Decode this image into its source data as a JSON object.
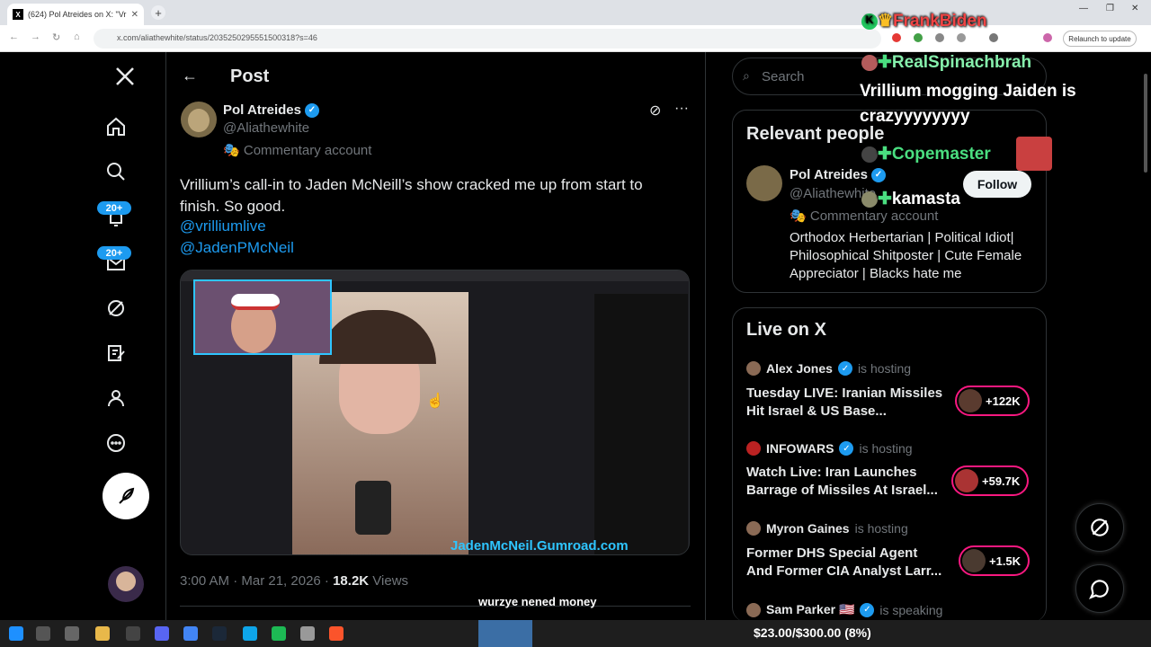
{
  "browser": {
    "tab_title": "(624) Pol Atreides on X: \"Vr",
    "url": "x.com/aliathewhite/status/2035250295551500318?s=46",
    "relaunch_label": "Relaunch to update"
  },
  "nav": {
    "notifications_badge": "20+",
    "messages_badge": "20+"
  },
  "post": {
    "header": "Post",
    "author_name": "Pol Atreides",
    "author_handle": "@Aliathewhite",
    "account_label": "Commentary account",
    "text": "Vrillium’s call-in to Jaden McNeill’s show cracked me up from start to finish. So good.",
    "mention1": "@vrilliumlive",
    "mention2": "@JadenPMcNeil",
    "timestamp": "3:00 AM · Mar 21, 2026 · ",
    "views_count": "18.2K",
    "views_label": " Views",
    "media_watermark": "JadenMcNeil.Gumroad.com"
  },
  "right": {
    "search_placeholder": "Search",
    "relevant_title": "Relevant people",
    "rp_name": "Pol Atreides",
    "rp_handle": "@Aliathewhite",
    "rp_account": "Commentary account",
    "rp_bio": "Orthodox Herbertarian | Political Idiot| Philosophical Shitposter | Cute Female Appreciator | Blacks hate me",
    "follow_label": "Follow",
    "live_title": "Live on X",
    "live": [
      {
        "host": "Alex Jones",
        "status": "is hosting",
        "title": "Tuesday LIVE: Iranian Missiles Hit Israel & US Base...",
        "count": "+122K"
      },
      {
        "host": "INFOWARS",
        "status": "is hosting",
        "title": "Watch Live: Iran Launches Barrage of Missiles At Israel...",
        "count": "+59.7K"
      },
      {
        "host": "Myron Gaines",
        "status": "is hosting",
        "title": "Former DHS Special Agent And Former CIA Analyst Larr...",
        "count": "+1.5K"
      },
      {
        "host": "Sam Parker 🇺🇸",
        "status": "is speaking",
        "title": "",
        "count": ""
      }
    ]
  },
  "overlay": {
    "chat1_user": "FrankBiden",
    "chat2_user": "RealSpinachbrah",
    "chat2_msg": "Vrillium mogging Jaiden is crazyyyyyyyy",
    "chat3_user": "Copemaster",
    "chat4_user": "kamasta",
    "caption": "wurzye nened money",
    "donation": "$23.00/$300.00 (8%)"
  },
  "colors": {
    "accent": "#1d9bf0",
    "live": "#f91880",
    "chat_green": "#4ade80",
    "chat_red": "#ef4444"
  }
}
